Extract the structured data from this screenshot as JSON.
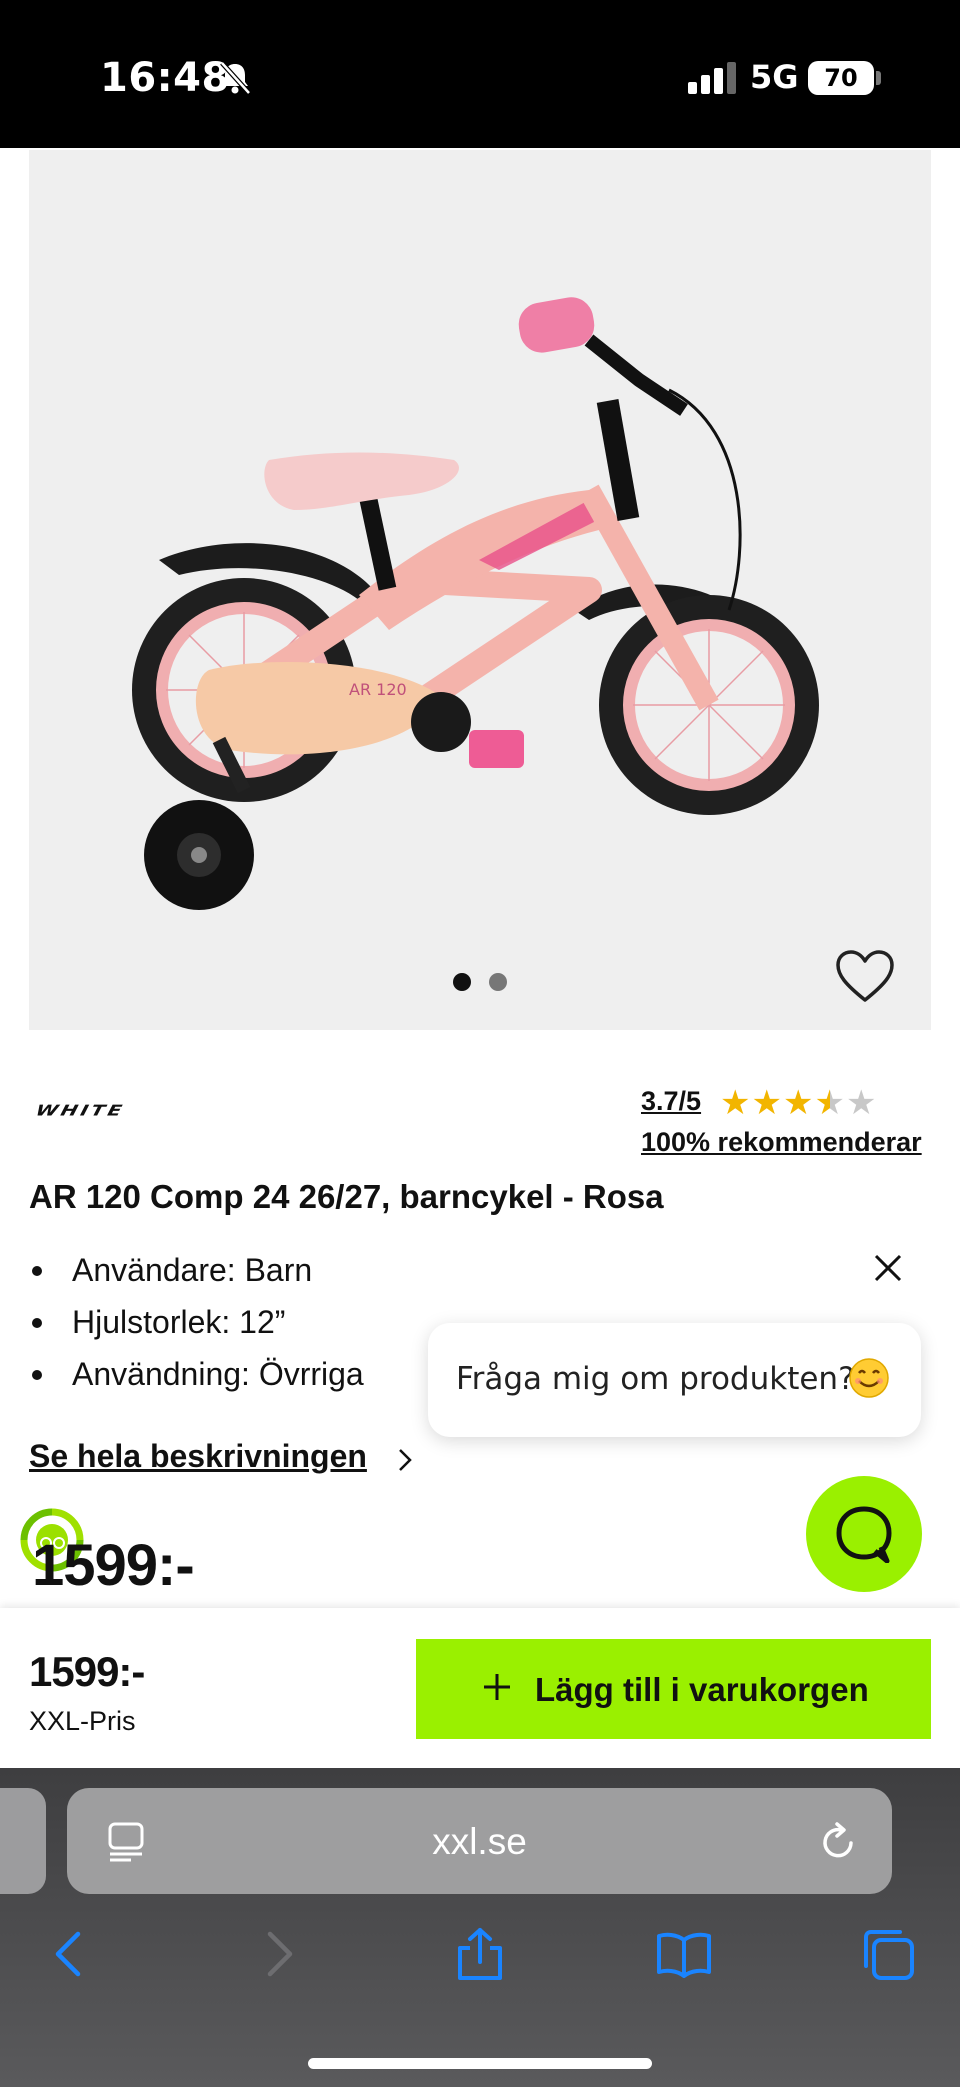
{
  "status_bar": {
    "time": "16:48",
    "network": "5G",
    "battery": "70"
  },
  "gallery": {
    "image_count": 2,
    "active_index": 0,
    "favorite_icon": "heart-icon"
  },
  "product": {
    "brand": "WHITE",
    "rating": "3.7/5",
    "stars_value": 3.5,
    "recommend": "100% rekommenderar",
    "title": "AR 120 Comp 24 26/27, barncykel - Rosa",
    "bullets": [
      "Användare: Barn",
      "Hjulstorlek: 12”",
      "Användning: Övrriga"
    ],
    "description_link": "Se hela beskrivningen",
    "old_price": "1599:-"
  },
  "chat": {
    "prompt": "Fråga mig om produkten?"
  },
  "purchase": {
    "price": "1599:-",
    "price_label": "XXL-Pris",
    "add_to_cart": "Lägg till i varukorgen",
    "accent": "#9af000"
  },
  "browser": {
    "url": "xxl.se"
  }
}
